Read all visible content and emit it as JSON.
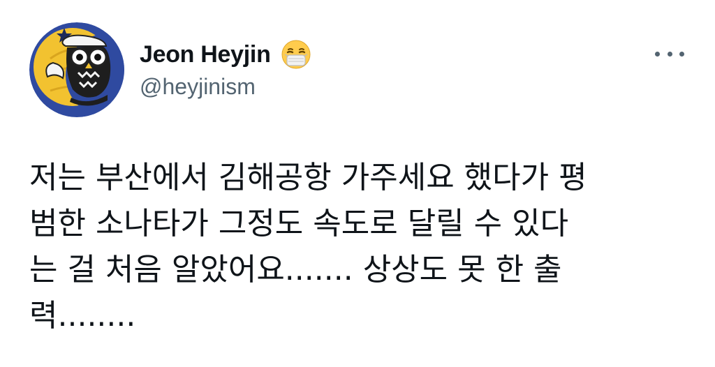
{
  "tweet": {
    "author": {
      "display_name": "Jeon Heyjin",
      "emoji": "face-with-medical-mask",
      "handle": "@heyjinism",
      "avatar": "owl-on-moon-avatar"
    },
    "more_icon": "more-horizontal-icon",
    "text_lines": [
      "저는 부산에서 김해공항 가주세요 했다가 평",
      "범한 소나타가 그정도 속도로 달릴 수 있다",
      "는 걸 처음 알았어요....... 상상도 못 한 출",
      "력........"
    ]
  },
  "colors": {
    "text": "#0f1419",
    "secondary": "#536471",
    "avatar_blue": "#2f4aa0",
    "avatar_yellow": "#f2c230"
  }
}
